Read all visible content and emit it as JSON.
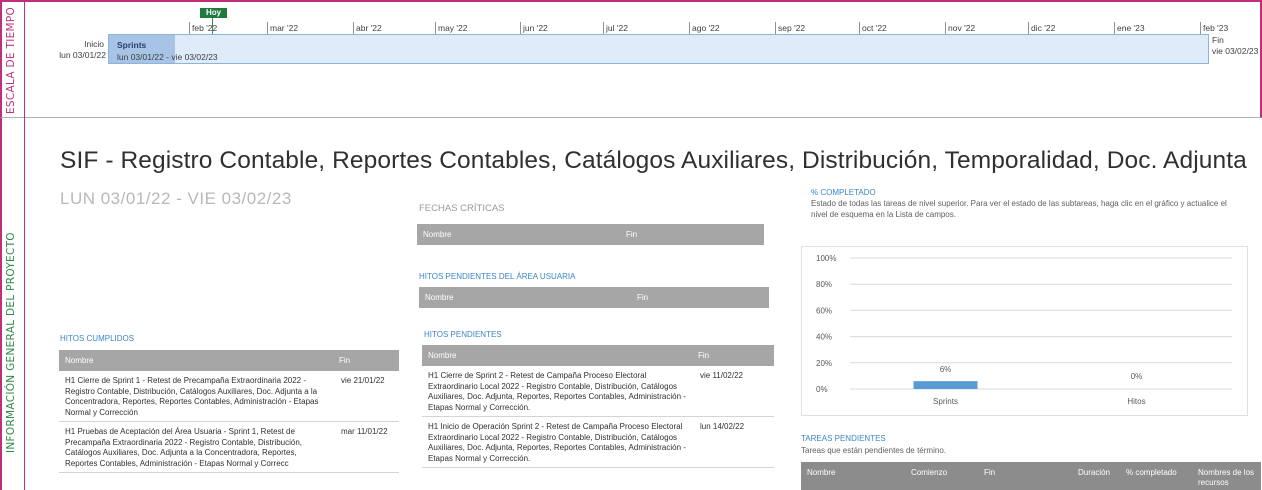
{
  "timeline": {
    "side_label": "ESCALA DE TIEMPO",
    "today_label": "Hoy",
    "ticks": [
      "feb '22",
      "mar '22",
      "abr '22",
      "may '22",
      "jun '22",
      "jul '22",
      "ago '22",
      "sep '22",
      "oct '22",
      "nov '22",
      "dic '22",
      "ene '23",
      "feb '23"
    ],
    "start_label": "Inicio",
    "start_date": "lun 03/01/22",
    "end_label": "Fin",
    "end_date": "vie 03/02/23",
    "bar": {
      "name": "Sprints",
      "dates": "lun 03/01/22 - vie 03/02/23",
      "percent_complete": 6
    }
  },
  "info": {
    "side_label": "INFORMACIÓN GENERAL DEL PROYECTO",
    "title": "SIF - Registro Contable, Reportes Contables, Catálogos Auxiliares, Distribución, Temporalidad, Doc. Adjunta",
    "dates": "LUN 03/01/22 - VIE 03/02/23",
    "fechas_criticas": {
      "label": "FECHAS CRÍTICAS",
      "headers": [
        "Nombre",
        "Fin"
      ]
    },
    "hitos_usuaria": {
      "label": "HITOS PENDIENTES DEL ÁREA USUARIA",
      "headers": [
        "Nombre",
        "Fin"
      ]
    },
    "hitos_cumplidos": {
      "label": "HITOS CUMPLIDOS",
      "headers": [
        "Nombre",
        "Fin"
      ],
      "rows": [
        {
          "name": "H1 Cierre de Sprint 1 - Retest de Precampaña Extraordinaria 2022 - Registro Contable, Distribución, Catálogos Auxiliares, Doc. Adjunta a la Concentradora, Reportes, Reportes Contables, Administración - Etapas Normal y Corrección",
          "fin": "vie 21/01/22"
        },
        {
          "name": "H1 Pruebas de Aceptación del Área Usuaria - Sprint 1, Retest de Precampaña Extraordinaria 2022 - Registro Contable, Distribución, Catálogos Auxiliares, Doc. Adjunta a la Concentradora, Reportes, Reportes Contables, Administración - Etapas Normal y Correcc",
          "fin": "mar 11/01/22"
        }
      ]
    },
    "hitos_pendientes": {
      "label": "HITOS PENDIENTES",
      "headers": [
        "Nombre",
        "Fin"
      ],
      "rows": [
        {
          "name": "H1 Cierre de Sprint 2 - Retest de Campaña Proceso Electoral Extraordinario Local 2022 - Registro Contable, Distribución, Catálogos Auxiliares, Doc. Adjunta, Reportes, Reportes Contables, Administración - Etapas Normal y Corrección.",
          "fin": "vie 11/02/22"
        },
        {
          "name": "H1 Inicio de Operación Sprint 2 - Retest de Campaña Proceso Electoral Extraordinario Local 2022 - Registro Contable, Distribución, Catálogos Auxiliares, Doc. Adjunta, Reportes, Reportes Contables, Administración - Etapas Normal y Corrección.",
          "fin": "lun 14/02/22"
        }
      ]
    },
    "pct_completado": {
      "label": "% COMPLETADO",
      "description": "Estado de todas las tareas de nivel superior. Para ver el estado de las subtareas, haga clic en el gráfico y actualice el nivel de esquema en la Lista de campos."
    },
    "tareas_pendientes": {
      "label": "TAREAS PENDIENTES",
      "description": "Tareas que están pendientes de término.",
      "headers": [
        "Nombre",
        "Comienzo",
        "Fin",
        "Duración",
        "% completado",
        "Nombres de los recursos"
      ]
    }
  },
  "chart_data": {
    "type": "bar",
    "categories": [
      "Sprints",
      "Hitos"
    ],
    "values": [
      6,
      0
    ],
    "data_labels": [
      "6%",
      "0%"
    ],
    "ylim": [
      0,
      100
    ],
    "y_ticks": [
      "0%",
      "20%",
      "40%",
      "60%",
      "80%",
      "100%"
    ],
    "grid": true,
    "bar_color": "#5b9bd5"
  }
}
